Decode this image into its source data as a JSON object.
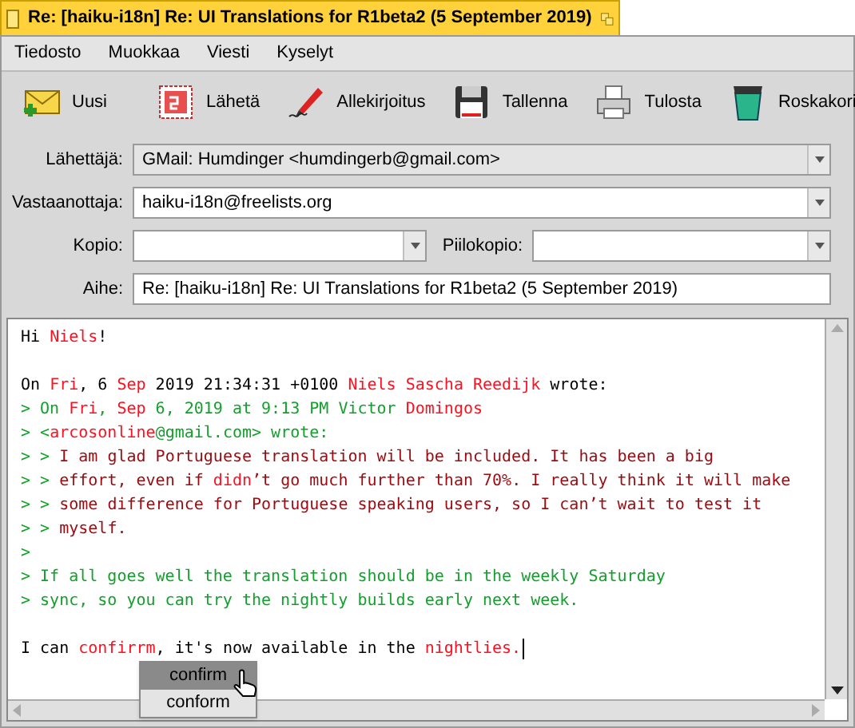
{
  "window": {
    "title": "Re: [haiku-i18n] Re: UI Translations for R1beta2 (5 September 2019)"
  },
  "menu": [
    "Tiedosto",
    "Muokkaa",
    "Viesti",
    "Kyselyt"
  ],
  "toolbar": [
    {
      "label": "Uusi",
      "kind": "new"
    },
    {
      "label": "Lähetä",
      "kind": "send"
    },
    {
      "label": "Allekirjoitus",
      "kind": "signature"
    },
    {
      "label": "Tallenna",
      "kind": "save"
    },
    {
      "label": "Tulosta",
      "kind": "print"
    },
    {
      "label": "Roskakori",
      "kind": "trash"
    }
  ],
  "from": {
    "label": "Lähettäjä:",
    "value": "GMail:  Humdinger <humdingerb@gmail.com>"
  },
  "to": {
    "label": "Vastaanottaja:",
    "value": "haiku-i18n@freelists.org"
  },
  "cc": {
    "label": "Kopio:"
  },
  "bcc": {
    "label": "Piilokopio:"
  },
  "subject": {
    "label": "Aihe:",
    "value": "Re: [haiku-i18n] Re: UI Translations for R1beta2 (5 September 2019)"
  },
  "body": [
    {
      "kind": "text",
      "segments": [
        {
          "text": "Hi ",
          "color": "#000000"
        },
        {
          "text": "Niels",
          "color": "#ff1020"
        },
        {
          "text": "!",
          "color": "#000000"
        }
      ]
    },
    {
      "kind": "blank"
    },
    {
      "kind": "text",
      "segments": [
        {
          "text": "On ",
          "color": "#000000"
        },
        {
          "text": "Fri",
          "color": "#ff1020"
        },
        {
          "text": ", 6 ",
          "color": "#000000"
        },
        {
          "text": "Sep",
          "color": "#ff1020"
        },
        {
          "text": " 2019 21:34:31 +0100 ",
          "color": "#000000"
        },
        {
          "text": "Niels Sascha Reedijk",
          "color": "#ff1020"
        },
        {
          "text": " wrote:",
          "color": "#000000"
        }
      ]
    },
    {
      "kind": "text",
      "segments": [
        {
          "text": "> On ",
          "color": "#13a02c"
        },
        {
          "text": "Fri",
          "color": "#ff1020"
        },
        {
          "text": ", ",
          "color": "#13a02c"
        },
        {
          "text": "Sep",
          "color": "#ff1020"
        },
        {
          "text": " 6, 2019 at 9:13 PM Victor ",
          "color": "#13a02c"
        },
        {
          "text": "Domingos",
          "color": "#ff1020"
        }
      ]
    },
    {
      "kind": "text",
      "segments": [
        {
          "text": "> <",
          "color": "#13a02c"
        },
        {
          "text": "arcosonline",
          "color": "#ff1020"
        },
        {
          "text": "@gmail.com> wrote:",
          "color": "#13a02c"
        }
      ]
    },
    {
      "kind": "text",
      "segments": [
        {
          "text": "> > ",
          "color": "#13a02c"
        },
        {
          "text": "I am glad Portuguese translation will be included. It has been a big",
          "color": "#9c0a10"
        }
      ]
    },
    {
      "kind": "text",
      "segments": [
        {
          "text": "> > ",
          "color": "#13a02c"
        },
        {
          "text": "effort, even if ",
          "color": "#9c0a10"
        },
        {
          "text": "didn",
          "color": "#ff1020"
        },
        {
          "text": "’t go much further than 70%. I really think it will make",
          "color": "#9c0a10"
        }
      ]
    },
    {
      "kind": "text",
      "segments": [
        {
          "text": "> > ",
          "color": "#13a02c"
        },
        {
          "text": "some difference for Portuguese speaking users, so I can’t wait to test it",
          "color": "#9c0a10"
        }
      ]
    },
    {
      "kind": "text",
      "segments": [
        {
          "text": "> > ",
          "color": "#13a02c"
        },
        {
          "text": "myself.",
          "color": "#9c0a10"
        }
      ]
    },
    {
      "kind": "text",
      "segments": [
        {
          "text": ">",
          "color": "#13a02c"
        }
      ]
    },
    {
      "kind": "text",
      "segments": [
        {
          "text": "> If all goes well the translation should be in the weekly Saturday",
          "color": "#13a02c"
        }
      ]
    },
    {
      "kind": "text",
      "segments": [
        {
          "text": "> sync, so you can try the nightly builds early next week.",
          "color": "#13a02c"
        }
      ]
    },
    {
      "kind": "blank"
    },
    {
      "kind": "cursor",
      "segments": [
        {
          "text": "I can ",
          "color": "#000000"
        },
        {
          "text": "confirrm",
          "color": "#ff1020"
        },
        {
          "text": ", it's now available in the ",
          "color": "#000000"
        },
        {
          "text": "nightlies.",
          "color": "#ff1020"
        }
      ]
    }
  ],
  "suggestions": [
    {
      "label": "confirm",
      "selected": true
    },
    {
      "label": "conform",
      "selected": false
    }
  ]
}
